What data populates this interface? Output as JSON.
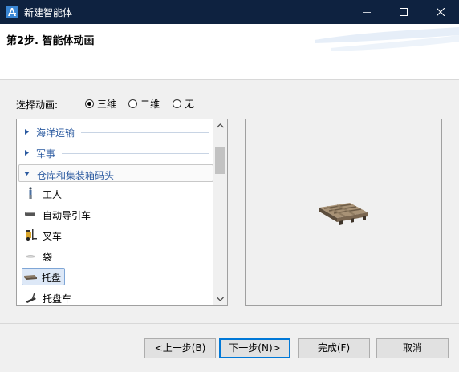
{
  "window": {
    "title": "新建智能体"
  },
  "header": {
    "title": "第2步. 智能体动画"
  },
  "animation_option": {
    "label": "选择动画:",
    "options": [
      {
        "label": "三维",
        "selected": true
      },
      {
        "label": "二维",
        "selected": false
      },
      {
        "label": "无",
        "selected": false
      }
    ]
  },
  "list": {
    "categories": [
      {
        "label": "海洋运输",
        "expanded": false
      },
      {
        "label": "军事",
        "expanded": false
      },
      {
        "label": "仓库和集装箱码头",
        "expanded": true
      }
    ],
    "items": [
      {
        "label": "工人",
        "icon": "worker-icon"
      },
      {
        "label": "自动导引车",
        "icon": "agv-icon"
      },
      {
        "label": "叉车",
        "icon": "forklift-icon"
      },
      {
        "label": "袋",
        "icon": "bag-icon"
      },
      {
        "label": "托盘",
        "icon": "pallet-icon",
        "selected": true
      },
      {
        "label": "托盘车",
        "icon": "pallet-truck-icon"
      }
    ]
  },
  "preview": {
    "icon": "pallet-3d-preview"
  },
  "buttons": {
    "back": "<上一步(B)",
    "next": "下一步(N)>",
    "finish": "完成(F)",
    "cancel": "取消"
  },
  "colors": {
    "titlebar": "#0e2240",
    "category_text": "#2b5aa0",
    "selection": "#dde8f7"
  }
}
